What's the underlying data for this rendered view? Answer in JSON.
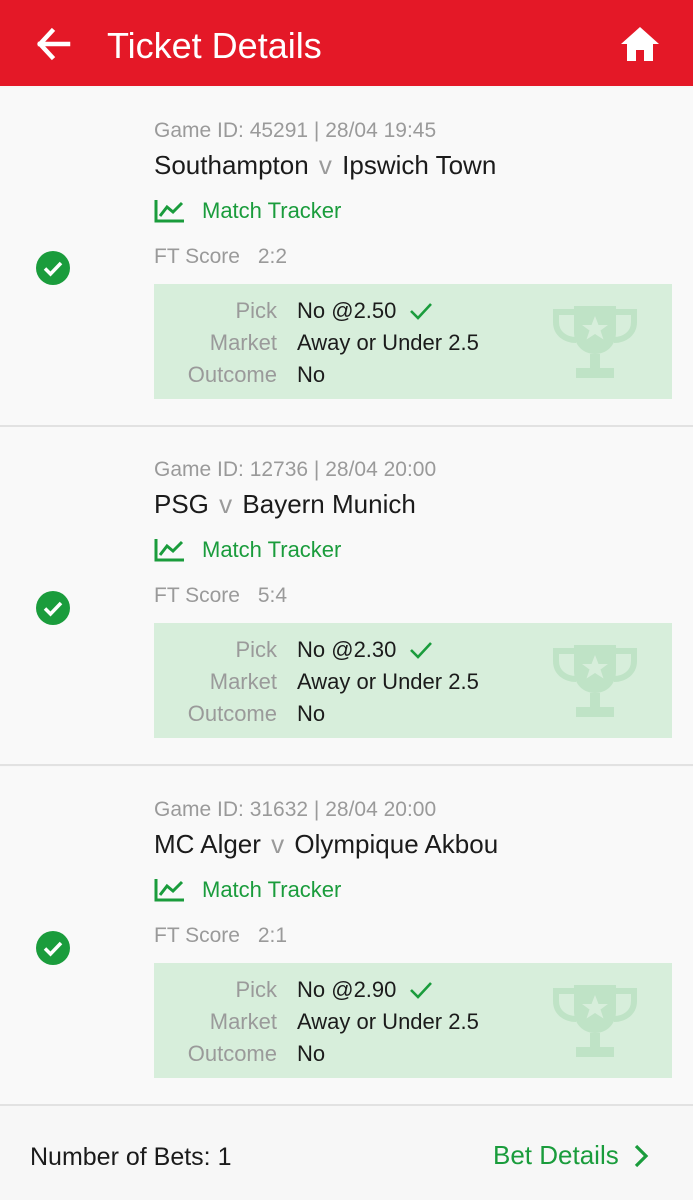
{
  "header": {
    "title": "Ticket Details"
  },
  "colors": {
    "brand_red": "#e41827",
    "accent_green": "#1a9c3c",
    "pick_box_bg": "#d7eedb"
  },
  "icons": {
    "back": "arrow-left-icon",
    "home": "home-icon",
    "won": "check-circle-icon",
    "tracker": "line-chart-icon",
    "pick_ok": "checkmark-icon",
    "trophy": "trophy-icon",
    "chevron": "chevron-right-icon"
  },
  "labels": {
    "match_tracker": "Match Tracker",
    "ft_score": "FT Score",
    "pick": "Pick",
    "market": "Market",
    "outcome": "Outcome",
    "versus": "v"
  },
  "bets": [
    {
      "game_line": "Game ID: 45291 | 28/04 19:45",
      "home": "Southampton",
      "away": "Ipswich Town",
      "ft_score": "2:2",
      "pick": "No @2.50",
      "market": "Away or Under 2.5",
      "outcome": "No"
    },
    {
      "game_line": "Game ID: 12736 | 28/04 20:00",
      "home": "PSG",
      "away": "Bayern Munich",
      "ft_score": "5:4",
      "pick": "No @2.30",
      "market": "Away or Under 2.5",
      "outcome": "No"
    },
    {
      "game_line": "Game ID: 31632 | 28/04 20:00",
      "home": "MC Alger",
      "away": "Olympique Akbou",
      "ft_score": "2:1",
      "pick": "No @2.90",
      "market": "Away or Under 2.5",
      "outcome": "No"
    }
  ],
  "footer": {
    "number_of_bets": "Number of Bets: 1",
    "bet_details": "Bet Details"
  }
}
